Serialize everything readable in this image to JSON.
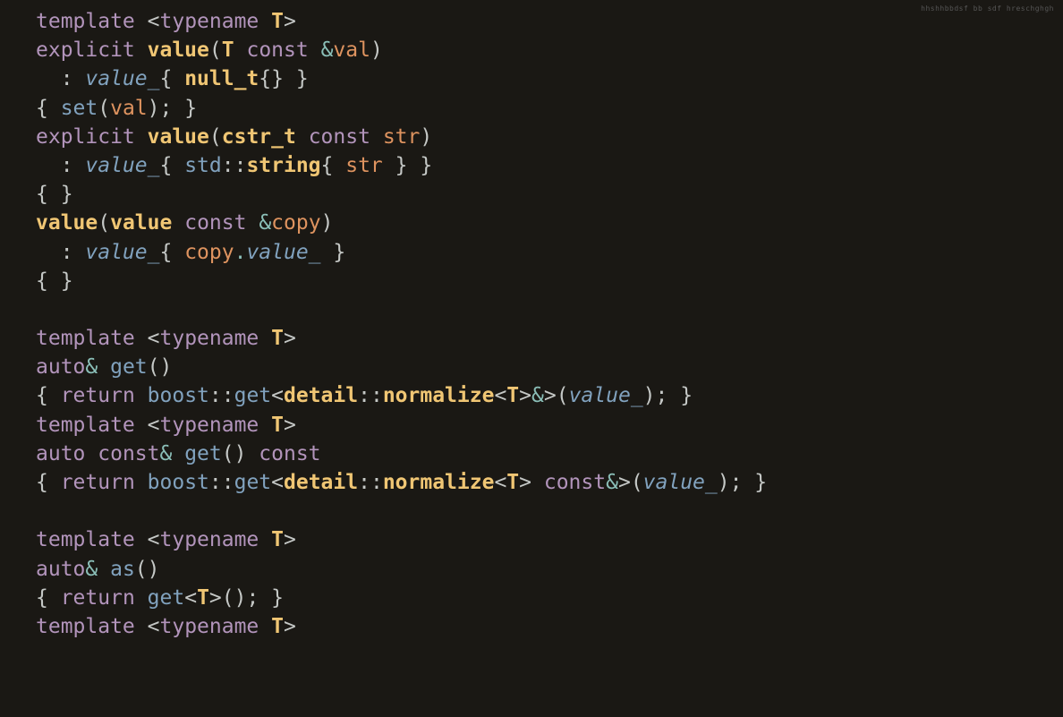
{
  "watermark": "hhshhbbdsf bb sdf hreschghgh",
  "tokens": [
    [
      [
        "kw",
        "template"
      ],
      [
        "pn",
        " "
      ],
      [
        "pn",
        "<"
      ],
      [
        "kw",
        "typename"
      ],
      [
        "pn",
        " "
      ],
      [
        "ty",
        "T"
      ],
      [
        "pn",
        ">"
      ]
    ],
    [
      [
        "kw",
        "explicit"
      ],
      [
        "pn",
        " "
      ],
      [
        "ty",
        "value"
      ],
      [
        "pn",
        "("
      ],
      [
        "ty",
        "T"
      ],
      [
        "pn",
        " "
      ],
      [
        "kw",
        "const"
      ],
      [
        "op",
        " &"
      ],
      [
        "pa",
        "val"
      ],
      [
        "pn",
        ")"
      ]
    ],
    [
      [
        "pn",
        "  : "
      ],
      [
        "mem",
        "value_"
      ],
      [
        "pn",
        "{ "
      ],
      [
        "ty",
        "null_t"
      ],
      [
        "pn",
        "{} }"
      ]
    ],
    [
      [
        "pn",
        "{ "
      ],
      [
        "fn",
        "set"
      ],
      [
        "pn",
        "("
      ],
      [
        "pa",
        "val"
      ],
      [
        "pn",
        "); }"
      ]
    ],
    [
      [
        "kw",
        "explicit"
      ],
      [
        "pn",
        " "
      ],
      [
        "ty",
        "value"
      ],
      [
        "pn",
        "("
      ],
      [
        "ty",
        "cstr_t"
      ],
      [
        "pn",
        " "
      ],
      [
        "kw",
        "const"
      ],
      [
        "pn",
        " "
      ],
      [
        "pa",
        "str"
      ],
      [
        "pn",
        ")"
      ]
    ],
    [
      [
        "pn",
        "  : "
      ],
      [
        "mem",
        "value_"
      ],
      [
        "pn",
        "{ "
      ],
      [
        "ns",
        "std"
      ],
      [
        "pn",
        "::"
      ],
      [
        "ty",
        "string"
      ],
      [
        "pn",
        "{ "
      ],
      [
        "pa",
        "str"
      ],
      [
        "pn",
        " } }"
      ]
    ],
    [
      [
        "pn",
        "{ }"
      ]
    ],
    [
      [
        "ty",
        "value"
      ],
      [
        "pn",
        "("
      ],
      [
        "ty",
        "value"
      ],
      [
        "pn",
        " "
      ],
      [
        "kw",
        "const"
      ],
      [
        "op",
        " &"
      ],
      [
        "pa",
        "copy"
      ],
      [
        "pn",
        ")"
      ]
    ],
    [
      [
        "pn",
        "  : "
      ],
      [
        "mem",
        "value_"
      ],
      [
        "pn",
        "{ "
      ],
      [
        "pa",
        "copy"
      ],
      [
        "op",
        "."
      ],
      [
        "mem",
        "value_"
      ],
      [
        "pn",
        " }"
      ]
    ],
    [
      [
        "pn",
        "{ }"
      ]
    ],
    [
      [
        "pn",
        ""
      ]
    ],
    [
      [
        "kw",
        "template"
      ],
      [
        "pn",
        " "
      ],
      [
        "pn",
        "<"
      ],
      [
        "kw",
        "typename"
      ],
      [
        "pn",
        " "
      ],
      [
        "ty",
        "T"
      ],
      [
        "pn",
        ">"
      ]
    ],
    [
      [
        "kw",
        "auto"
      ],
      [
        "op",
        "& "
      ],
      [
        "fn",
        "get"
      ],
      [
        "pn",
        "()"
      ]
    ],
    [
      [
        "pn",
        "{ "
      ],
      [
        "kw",
        "return"
      ],
      [
        "pn",
        " "
      ],
      [
        "ns",
        "boost"
      ],
      [
        "pn",
        "::"
      ],
      [
        "fn",
        "get"
      ],
      [
        "pn",
        "<"
      ],
      [
        "ty",
        "detail"
      ],
      [
        "pn",
        "::"
      ],
      [
        "ty",
        "normalize"
      ],
      [
        "pn",
        "<"
      ],
      [
        "ty",
        "T"
      ],
      [
        "pn",
        ">"
      ],
      [
        "op",
        "&"
      ],
      [
        "pn",
        ">("
      ],
      [
        "mem",
        "value_"
      ],
      [
        "pn",
        "); }"
      ]
    ],
    [
      [
        "kw",
        "template"
      ],
      [
        "pn",
        " "
      ],
      [
        "pn",
        "<"
      ],
      [
        "kw",
        "typename"
      ],
      [
        "pn",
        " "
      ],
      [
        "ty",
        "T"
      ],
      [
        "pn",
        ">"
      ]
    ],
    [
      [
        "kw",
        "auto"
      ],
      [
        "pn",
        " "
      ],
      [
        "kw",
        "const"
      ],
      [
        "op",
        "& "
      ],
      [
        "fn",
        "get"
      ],
      [
        "pn",
        "() "
      ],
      [
        "kw",
        "const"
      ]
    ],
    [
      [
        "pn",
        "{ "
      ],
      [
        "kw",
        "return"
      ],
      [
        "pn",
        " "
      ],
      [
        "ns",
        "boost"
      ],
      [
        "pn",
        "::"
      ],
      [
        "fn",
        "get"
      ],
      [
        "pn",
        "<"
      ],
      [
        "ty",
        "detail"
      ],
      [
        "pn",
        "::"
      ],
      [
        "ty",
        "normalize"
      ],
      [
        "pn",
        "<"
      ],
      [
        "ty",
        "T"
      ],
      [
        "pn",
        "> "
      ],
      [
        "kw",
        "const"
      ],
      [
        "op",
        "&"
      ],
      [
        "pn",
        ">("
      ],
      [
        "mem",
        "value_"
      ],
      [
        "pn",
        "); }"
      ]
    ],
    [
      [
        "pn",
        ""
      ]
    ],
    [
      [
        "kw",
        "template"
      ],
      [
        "pn",
        " "
      ],
      [
        "pn",
        "<"
      ],
      [
        "kw",
        "typename"
      ],
      [
        "pn",
        " "
      ],
      [
        "ty",
        "T"
      ],
      [
        "pn",
        ">"
      ]
    ],
    [
      [
        "kw",
        "auto"
      ],
      [
        "op",
        "& "
      ],
      [
        "fn",
        "as"
      ],
      [
        "pn",
        "()"
      ]
    ],
    [
      [
        "pn",
        "{ "
      ],
      [
        "kw",
        "return"
      ],
      [
        "pn",
        " "
      ],
      [
        "fn",
        "get"
      ],
      [
        "pn",
        "<"
      ],
      [
        "ty",
        "T"
      ],
      [
        "pn",
        ">(); }"
      ]
    ],
    [
      [
        "kw",
        "template"
      ],
      [
        "pn",
        " "
      ],
      [
        "pn",
        "<"
      ],
      [
        "kw",
        "typename"
      ],
      [
        "pn",
        " "
      ],
      [
        "ty",
        "T"
      ],
      [
        "pn",
        ">"
      ]
    ]
  ]
}
